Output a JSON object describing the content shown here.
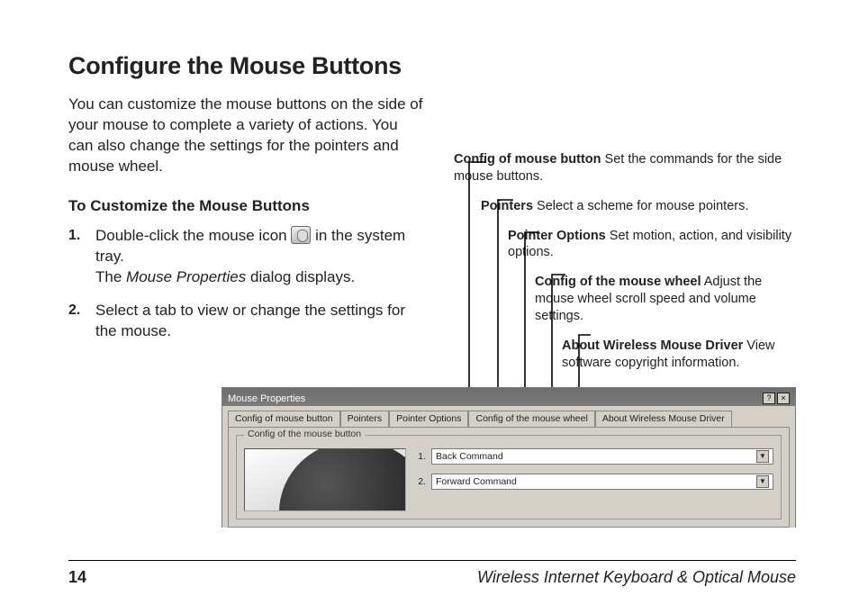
{
  "title": "Configure the Mouse Buttons",
  "intro": "You can customize the mouse buttons on the side of your mouse to complete a variety of actions. You can also change the settings for the pointers and mouse wheel.",
  "subhead": "To Customize the Mouse Buttons",
  "steps": {
    "n1": "1.",
    "s1a": "Double-click the mouse icon ",
    "s1b": " in the system tray.",
    "s1c": "The ",
    "s1c_i": "Mouse Properties",
    "s1d": " dialog displays.",
    "n2": "2.",
    "s2": "Select a tab to view or change the settings for the mouse."
  },
  "callouts": {
    "c1b": "Config of mouse button",
    "c1t": "    Set the commands for the side mouse buttons.",
    "c2b": "Pointers",
    "c2t": "    Select a scheme for mouse pointers.",
    "c3b": "Pointer Options",
    "c3t": "    Set motion, action, and visibility options.",
    "c4b": "Config of the mouse wheel",
    "c4t": "    Adjust the mouse wheel scroll speed and volume settings.",
    "c5b": "About Wireless Mouse Driver",
    "c5t": "    View software copyright information."
  },
  "dialog": {
    "title": "Mouse Properties",
    "tabs": [
      "Config of mouse button",
      "Pointers",
      "Pointer Options",
      "Config of the mouse wheel",
      "About Wireless Mouse Driver"
    ],
    "fieldset": "Config of the mouse button",
    "row1n": "1.",
    "row1v": "Back Command",
    "row2n": "2.",
    "row2v": "Forward Command"
  },
  "footer": {
    "page": "14",
    "book": "Wireless Internet Keyboard & Optical Mouse"
  }
}
